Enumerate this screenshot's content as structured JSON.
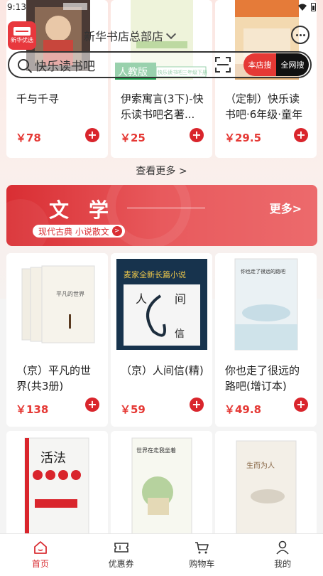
{
  "status_bar": {
    "time": "9:13"
  },
  "header": {
    "logo_text": "新华优选",
    "store_name": "新华书店总部店",
    "search_placeholder": "快乐读书吧",
    "scope_shop": "本店搜",
    "scope_all": "全网搜"
  },
  "top_products": [
    {
      "title": "千与千寻",
      "price": "￥78"
    },
    {
      "title": "伊索寓言(3下)-快乐读书吧名著...",
      "price": "￥25"
    },
    {
      "title": "（定制）快乐读书吧·6年级·童年",
      "price": "￥29.5"
    }
  ],
  "see_more": "查看更多 >",
  "banner": {
    "title": "文学",
    "more": "更多>",
    "subtitle": "现代古典 小说散文"
  },
  "literature_products": [
    {
      "title": "（京）平凡的世界(共3册)",
      "price": "￥138",
      "cover_text": "平凡的世界"
    },
    {
      "title": "（京）人间信(精)",
      "price": "￥59",
      "cover_text": "麦家全新长篇小说"
    },
    {
      "title": "你也走了很远的路吧(增订本)",
      "price": "￥49.8",
      "cover_text": "你也走了很远的路吧"
    }
  ],
  "more_products": [
    {
      "cover_text": "活法"
    },
    {
      "cover_text": "世界在走我坐着"
    },
    {
      "cover_text": "生而为人"
    }
  ],
  "bottom_nav": [
    {
      "label": "首页",
      "icon": "home-icon",
      "active": true
    },
    {
      "label": "优惠券",
      "icon": "coupon-icon",
      "active": false
    },
    {
      "label": "购物车",
      "icon": "cart-icon",
      "active": false
    },
    {
      "label": "我的",
      "icon": "user-icon",
      "active": false
    }
  ],
  "colors": {
    "accent": "#d9252c",
    "price": "#e53935"
  }
}
